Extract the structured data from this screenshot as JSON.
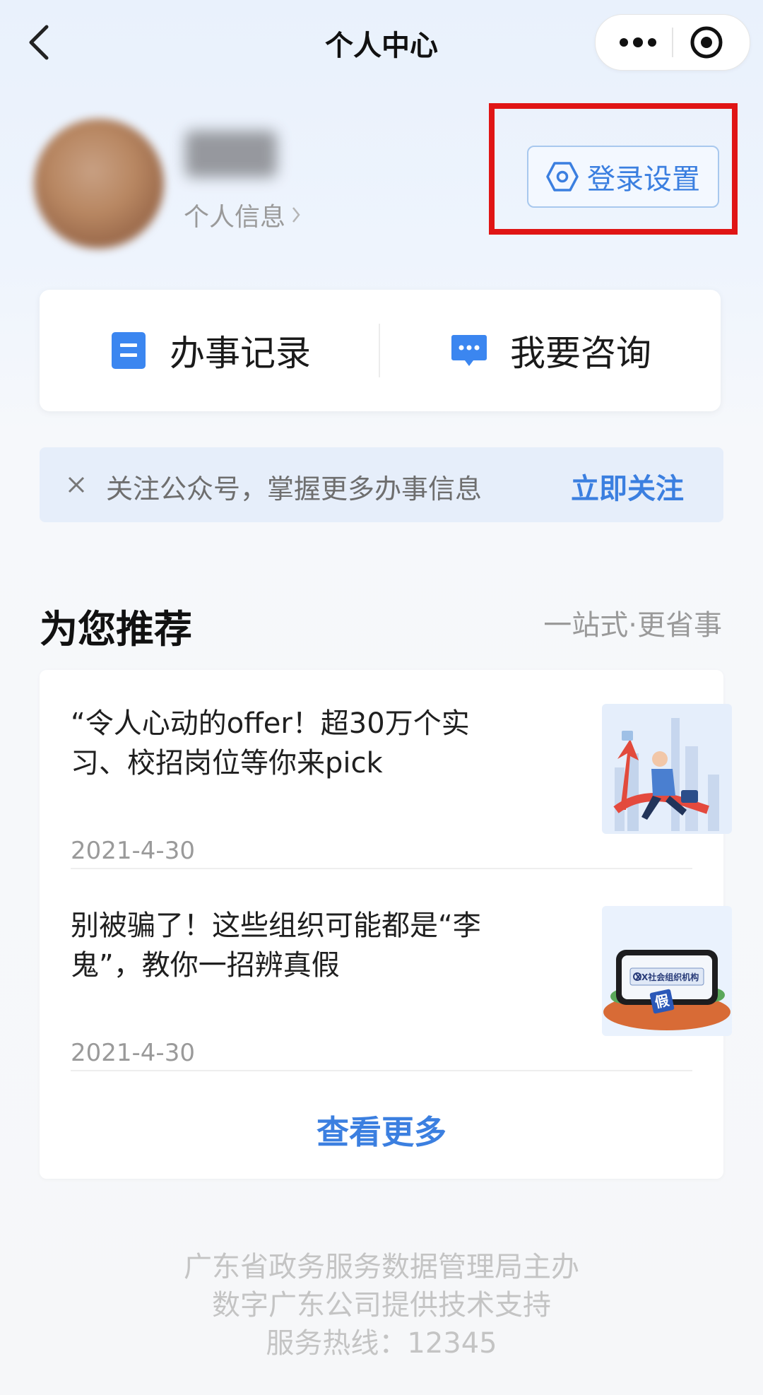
{
  "nav": {
    "title": "个人中心"
  },
  "profile": {
    "info_link": "个人信息"
  },
  "login_settings": {
    "label": "登录设置"
  },
  "actions": [
    {
      "label": "办事记录",
      "icon": "document-icon"
    },
    {
      "label": "我要咨询",
      "icon": "chat-icon"
    }
  ],
  "banner": {
    "text": "关注公众号，掌握更多办事信息",
    "action": "立即关注"
  },
  "recommend": {
    "title": "为您推荐",
    "subtitle": "一站式·更省事",
    "items": [
      {
        "title": "“令人心动的offer！超30万个实习、校招岗位等你来pick",
        "date": "2021-4-30"
      },
      {
        "title": "别被骗了！这些组织可能都是“李鬼”，教你一招辨真假",
        "date": "2021-4-30",
        "thumb_text": "XX社会组织机构",
        "thumb_stamp": "假"
      }
    ],
    "more": "查看更多"
  },
  "footer": {
    "line1": "广东省政务服务数据管理局主办",
    "line2": "数字广东公司提供技术支持",
    "line3": "服务热线：12345"
  },
  "colors": {
    "accent": "#3b7fe0",
    "highlight": "#e01515"
  }
}
